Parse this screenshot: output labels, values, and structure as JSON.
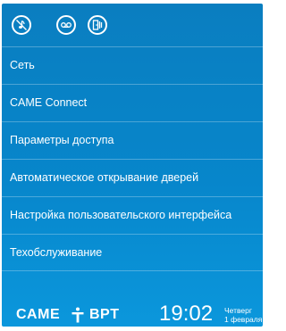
{
  "topbar": {
    "icons": [
      "music-mute-icon",
      "voicemail-icon",
      "door-open-icon"
    ]
  },
  "menu": {
    "items": [
      {
        "label": "Сеть"
      },
      {
        "label": "CAME Connect"
      },
      {
        "label": "Параметры доступа"
      },
      {
        "label": "Автоматическое открывание дверей"
      },
      {
        "label": "Настройка пользовательского интерфейса"
      },
      {
        "label": "Техобслуживание"
      }
    ]
  },
  "footer": {
    "brand_left": "CAME",
    "brand_right": "BPT",
    "time": "19:02",
    "weekday": "Четверг",
    "date": "1 февраля"
  },
  "colors": {
    "background_top": "#0a7ec0",
    "background_bottom": "#0b97dc",
    "text": "#ffffff"
  }
}
